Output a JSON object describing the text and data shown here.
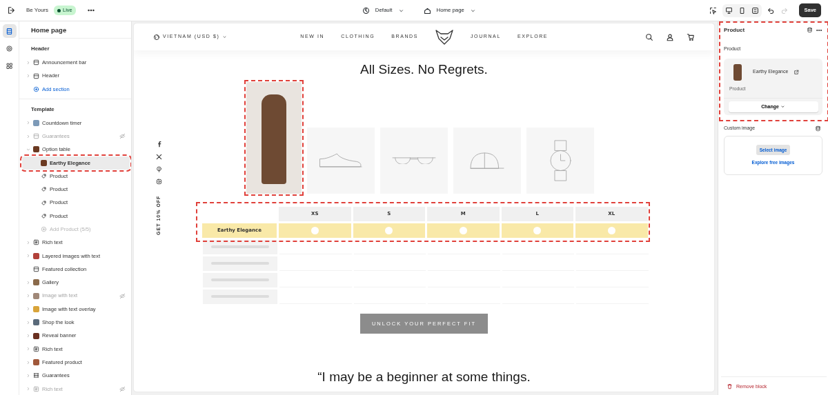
{
  "topbar": {
    "store": "Be Yours",
    "status": "Live",
    "theme": "Default",
    "page": "Home page",
    "save": "Save"
  },
  "rail": [
    {
      "kind": "sections",
      "selected": true
    },
    {
      "kind": "settings",
      "selected": false
    },
    {
      "kind": "apps",
      "selected": false
    }
  ],
  "sidebar": {
    "title": "Home page",
    "groups": [
      {
        "title": "Header",
        "items": [
          {
            "kind": "layout",
            "label": "Announcement bar",
            "expandable": true,
            "hidden": false,
            "selected": false
          },
          {
            "kind": "layout",
            "label": "Header",
            "expandable": true,
            "hidden": false,
            "selected": false
          },
          {
            "kind": "add",
            "label": "Add section",
            "disabled": false,
            "selected": false
          }
        ]
      },
      {
        "title": "Template",
        "items": [
          {
            "kind": "thumb",
            "color": "#7d9ab8",
            "label": "Countdown timer",
            "expandable": true,
            "hidden": false,
            "selected": false
          },
          {
            "kind": "layout",
            "label": "Guarantees",
            "expandable": true,
            "hidden": true,
            "selected": false
          },
          {
            "kind": "thumb",
            "color": "#6b3a22",
            "label": "Option table",
            "expandable": true,
            "expanded": true,
            "hidden": false,
            "selected": false,
            "children": [
              {
                "kind": "thumb",
                "color": "#6b3a22",
                "label": "Earthy Elegance",
                "selected": true
              },
              {
                "kind": "tag",
                "label": "Product",
                "selected": false
              },
              {
                "kind": "tag",
                "label": "Product",
                "selected": false
              },
              {
                "kind": "tag",
                "label": "Product",
                "selected": false
              },
              {
                "kind": "tag",
                "label": "Product",
                "selected": false
              },
              {
                "kind": "add",
                "label": "Add Product (5/5)",
                "disabled": true,
                "selected": false
              }
            ]
          },
          {
            "kind": "text",
            "label": "Rich text",
            "expandable": true,
            "hidden": false,
            "selected": false
          },
          {
            "kind": "thumb",
            "color": "#b2413a",
            "label": "Layered images with text",
            "expandable": true,
            "hidden": false,
            "selected": false
          },
          {
            "kind": "layout",
            "label": "Featured collection",
            "expandable": false,
            "hidden": false,
            "selected": false
          },
          {
            "kind": "thumb",
            "color": "#8a6a4a",
            "label": "Gallery",
            "expandable": true,
            "hidden": false,
            "selected": false
          },
          {
            "kind": "thumb",
            "color": "#a08878",
            "label": "Image with text",
            "expandable": true,
            "hidden": true,
            "selected": false
          },
          {
            "kind": "thumb",
            "color": "#d9a43a",
            "label": "Image with text overlay",
            "expandable": true,
            "hidden": false,
            "selected": false
          },
          {
            "kind": "thumb",
            "color": "#5a6a7a",
            "label": "Shop the look",
            "expandable": true,
            "hidden": false,
            "selected": false
          },
          {
            "kind": "thumb",
            "color": "#6a3020",
            "label": "Reveal banner",
            "expandable": true,
            "hidden": false,
            "selected": false
          },
          {
            "kind": "text",
            "label": "Rich text",
            "expandable": true,
            "hidden": false,
            "selected": false
          },
          {
            "kind": "thumb",
            "color": "#a0583a",
            "label": "Featured product",
            "expandable": true,
            "hidden": false,
            "selected": false
          },
          {
            "kind": "list",
            "label": "Guarantees",
            "expandable": true,
            "hidden": false,
            "selected": false
          },
          {
            "kind": "text",
            "label": "Rich text",
            "expandable": true,
            "hidden": true,
            "selected": false
          }
        ]
      }
    ]
  },
  "preview": {
    "locale": "VIETNAM (USD $)",
    "nav": [
      "NEW IN",
      "CLOTHING",
      "BRANDS",
      "JOURNAL",
      "EXPLORE"
    ],
    "heading": "All Sizes. No Regrets.",
    "promo": "GET 10% OFF",
    "products": [
      {
        "kind": "photo"
      },
      {
        "kind": "shoe"
      },
      {
        "kind": "glasses"
      },
      {
        "kind": "cap"
      },
      {
        "kind": "watch"
      }
    ],
    "table": {
      "sizes": [
        "XS",
        "S",
        "M",
        "L",
        "XL"
      ],
      "product": "Earthy Elegance",
      "skeleton_rows": [
        {
          "kind": "skeleton"
        },
        {
          "kind": "skeleton"
        },
        {
          "kind": "skeleton"
        },
        {
          "kind": "skeleton"
        }
      ]
    },
    "button": "UNLOCK YOUR PERFECT FIT",
    "quote": "“I may be a beginner at some things."
  },
  "panel": {
    "title": "Product",
    "field_label": "Product",
    "product_name": "Earthy Elegance",
    "product_type": "Product",
    "change": "Change",
    "custom_image_label": "Custom image",
    "select_image": "Select image",
    "explore": "Explore free images",
    "remove": "Remove block"
  }
}
